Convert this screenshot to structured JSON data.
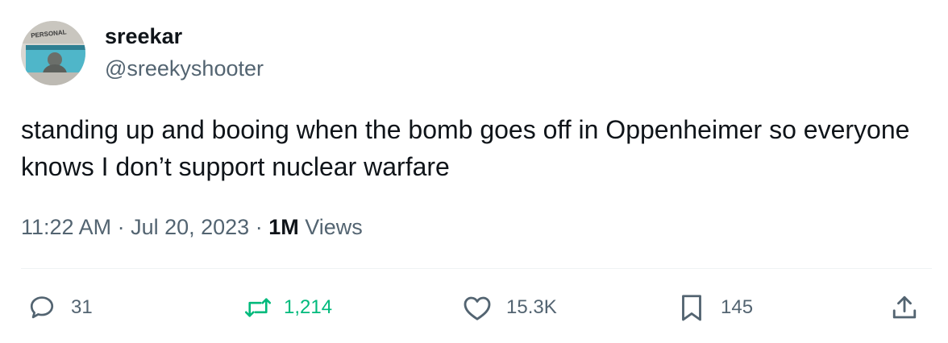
{
  "author": {
    "name": "sreekar",
    "handle": "@sreekyshooter",
    "avatar_icon": "profile-photo",
    "avatar_badge_text": "PERSONAL"
  },
  "tweet": {
    "text": "standing up and booing when the bomb goes off in Oppenheimer so everyone knows I don’t support nuclear warfare",
    "time": "11:22 AM",
    "separator": " · ",
    "date": "Jul 20, 2023",
    "views_count": "1M",
    "views_label": " Views"
  },
  "actions": {
    "reply": {
      "icon": "reply-icon",
      "count": "31"
    },
    "retweet": {
      "icon": "retweet-icon",
      "count": "1,214",
      "color": "#00ba7c"
    },
    "like": {
      "icon": "heart-icon",
      "count": "15.3K"
    },
    "bookmark": {
      "icon": "bookmark-icon",
      "count": "145"
    },
    "share": {
      "icon": "share-icon"
    }
  },
  "colors": {
    "text_primary": "#0f1419",
    "text_secondary": "#536471",
    "retweet_active": "#00ba7c",
    "divider": "#eff3f4"
  }
}
